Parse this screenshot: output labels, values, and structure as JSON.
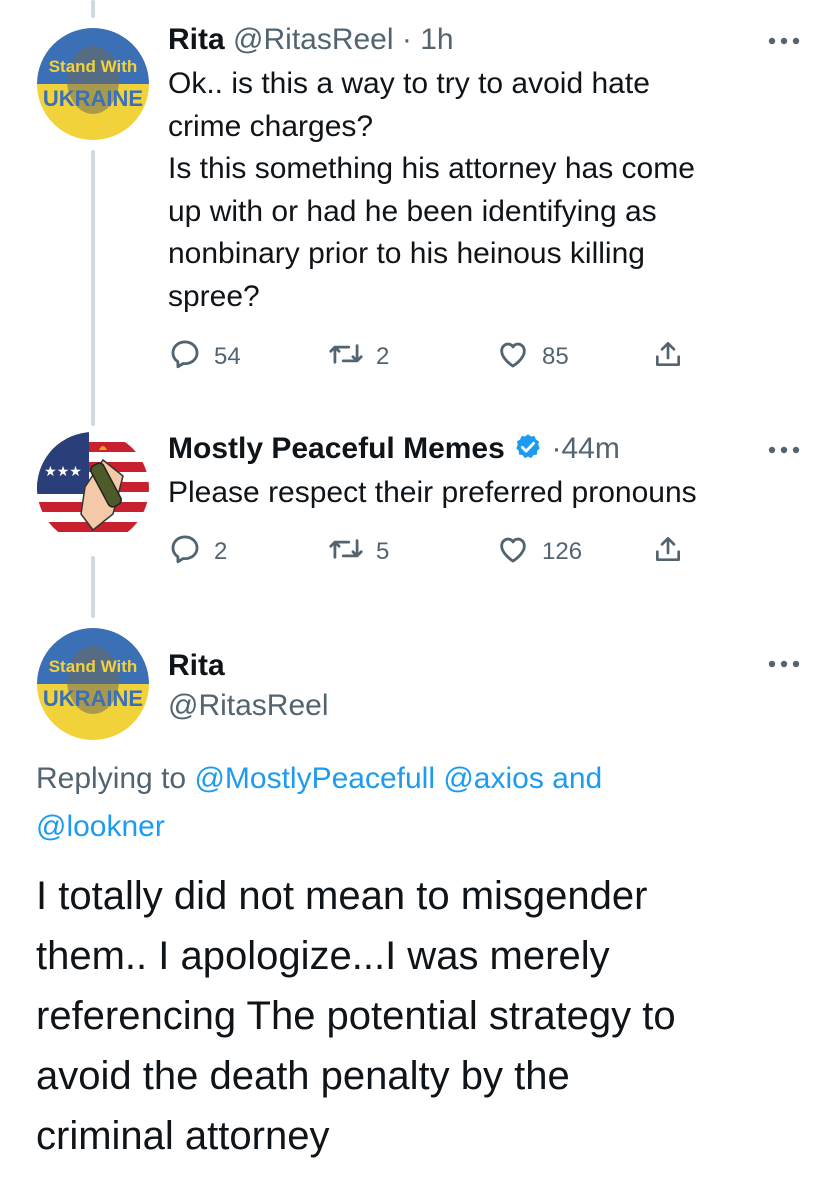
{
  "tweets": [
    {
      "name": "Rita",
      "handle": "@RitasReel",
      "sep": "·",
      "time": "1h",
      "text": "Ok.. is this a way to try to avoid hate\ncrime charges?\nIs this something his attorney has come\nup with or had he been identifying as\nnonbinary prior to his heinous killing\nspree?",
      "reply_count": "54",
      "retweet_count": "2",
      "like_count": "85",
      "avatar_text_1": "Stand With",
      "avatar_text_2": "UKRAINE"
    },
    {
      "name": "Mostly Peaceful Memes",
      "sep": "·",
      "time": "44m",
      "text": "Please respect their preferred pronouns",
      "reply_count": "2",
      "retweet_count": "5",
      "like_count": "126"
    }
  ],
  "focus": {
    "name": "Rita",
    "handle": "@RitasReel",
    "replying_prefix": "Replying to",
    "mention_1": "@MostlyPeacefull",
    "mention_2": "@axios",
    "and_word": "and",
    "mention_3": "@lookner",
    "text": "I totally did not mean to misgender\nthem.. I apologize...I was merely\nreferencing The potential strategy to\navoid the death penalty by the\ncriminal attorney",
    "avatar_text_1": "Stand With",
    "avatar_text_2": "UKRAINE"
  },
  "colors": {
    "accent": "#1d9bf0",
    "secondary_text": "#536471",
    "thread_line": "#cfd9de"
  },
  "icons": [
    "more-icon",
    "reply-icon",
    "retweet-icon",
    "like-icon",
    "share-icon",
    "verified-badge-icon"
  ]
}
